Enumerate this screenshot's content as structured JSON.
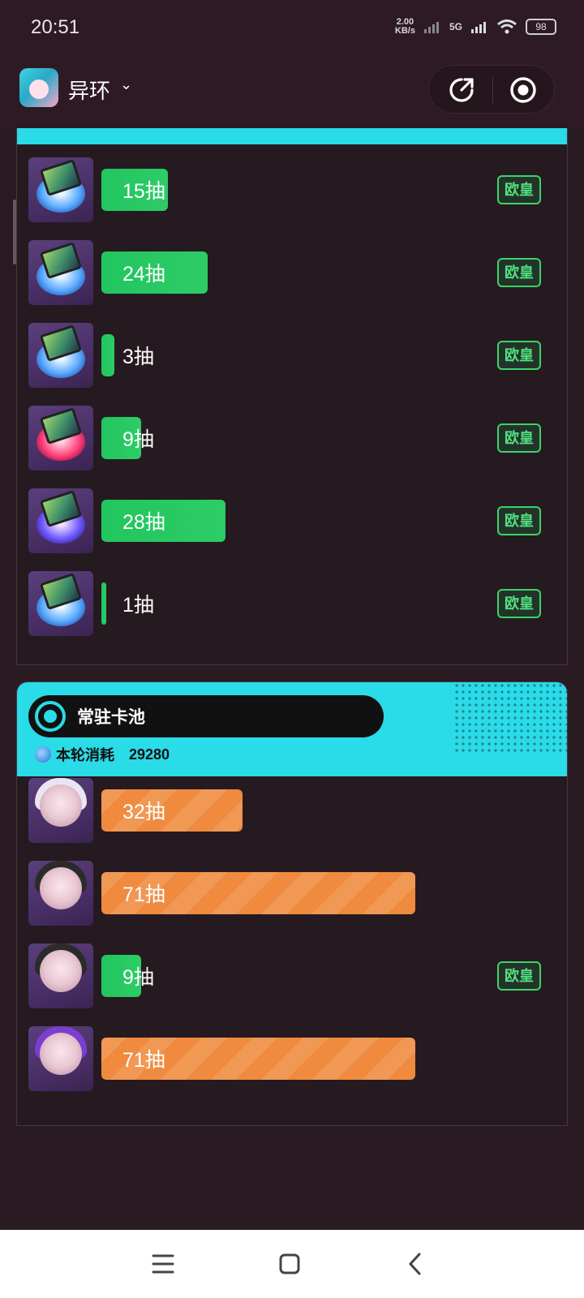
{
  "status_bar": {
    "time": "20:51",
    "net_speed_value": "2.00",
    "net_speed_unit": "KB/s",
    "network": "5G",
    "battery": "98"
  },
  "header": {
    "app_name": "异环",
    "dropdown_icon": "chevron-down-icon",
    "share_icon": "share-icon",
    "record_icon": "record-icon"
  },
  "pool_limited": {
    "rows": [
      {
        "label": "15抽",
        "pulls": 15,
        "bar_color": "green",
        "badge": "欧皇",
        "thumb": "blue"
      },
      {
        "label": "24抽",
        "pulls": 24,
        "bar_color": "green",
        "badge": "欧皇",
        "thumb": "blue"
      },
      {
        "label": "3抽",
        "pulls": 3,
        "bar_color": "green",
        "badge": "欧皇",
        "thumb": "blue"
      },
      {
        "label": "9抽",
        "pulls": 9,
        "bar_color": "green",
        "badge": "欧皇",
        "thumb": "red"
      },
      {
        "label": "28抽",
        "pulls": 28,
        "bar_color": "green",
        "badge": "欧皇",
        "thumb": "purple"
      },
      {
        "label": "1抽",
        "pulls": 1,
        "bar_color": "green",
        "badge": "欧皇",
        "thumb": "blue"
      }
    ]
  },
  "pool_standard": {
    "title": "常驻卡池",
    "consume_label": "本轮消耗",
    "consume_value": "29280",
    "rows": [
      {
        "label": "32抽",
        "pulls": 32,
        "bar_color": "orange",
        "badge": "",
        "thumb": "white-hair"
      },
      {
        "label": "71抽",
        "pulls": 71,
        "bar_color": "orange",
        "badge": "",
        "thumb": "dark-hat"
      },
      {
        "label": "9抽",
        "pulls": 9,
        "bar_color": "green",
        "badge": "欧皇",
        "thumb": "dark-hat"
      },
      {
        "label": "71抽",
        "pulls": 71,
        "bar_color": "orange",
        "badge": "",
        "thumb": "purple-hair"
      }
    ]
  },
  "colors": {
    "background": "#2a1a22",
    "accent_cyan": "#2adbe8",
    "green": "#22c55e",
    "orange": "#ef8a3e"
  },
  "nav": {
    "menu_icon": "menu-icon",
    "home_icon": "home-square-icon",
    "back_icon": "back-chevron-icon"
  }
}
